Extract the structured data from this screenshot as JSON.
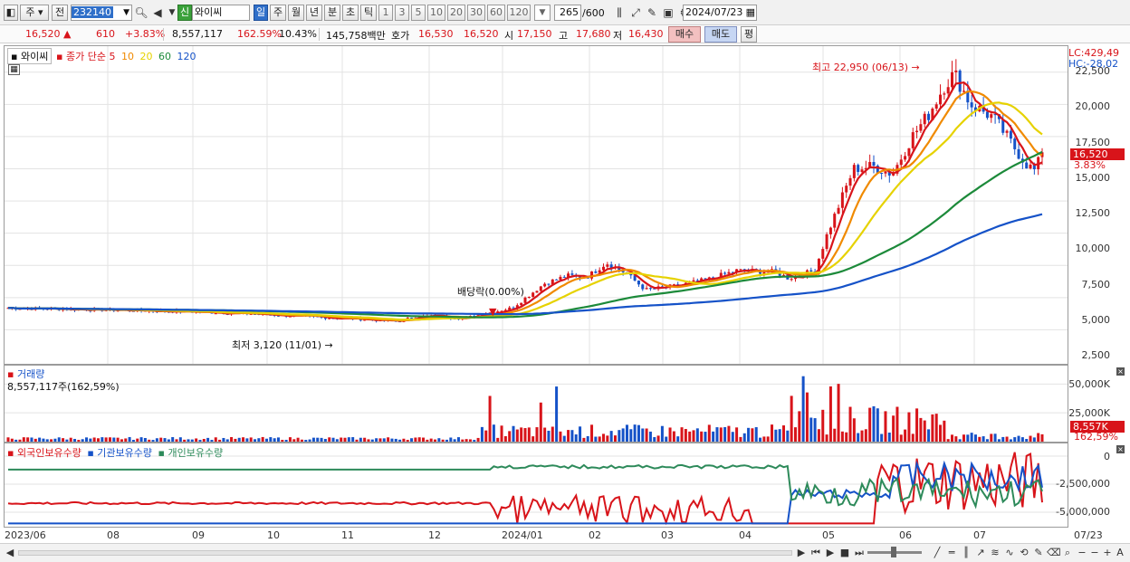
{
  "toolbar": {
    "period": "주",
    "compare": "전",
    "code": "232140",
    "credit": "신",
    "name": "와이씨",
    "tf": [
      "일",
      "주",
      "월",
      "년",
      "분",
      "초",
      "틱"
    ],
    "tf_active": "일",
    "ticks": [
      "1",
      "3",
      "5",
      "10",
      "20",
      "30",
      "60",
      "120"
    ],
    "count": "265",
    "count_total": "/600",
    "date": "2024/07/23"
  },
  "quote": {
    "price": "16,520",
    "change": "610",
    "rate": "+3.83%",
    "volume": "8,557,117",
    "vol_ratio": "162.59%",
    "turnover": "10.43%",
    "amount": "145,758백만",
    "ask_label": "호가",
    "ask": "16,530",
    "bid": "16,520",
    "open_label": "시",
    "open": "17,150",
    "high_label": "고",
    "high": "17,680",
    "low_label": "저",
    "low": "16,430",
    "buy": "매수",
    "sell": "매도",
    "eval": "평"
  },
  "price_legend": {
    "name": "와이씨",
    "ma": "종가 단순",
    "ma_periods": [
      {
        "p": "5",
        "color": "#d8141a"
      },
      {
        "p": "10",
        "color": "#f08a00"
      },
      {
        "p": "20",
        "color": "#e6d200"
      },
      {
        "p": "60",
        "color": "#1c8a3a"
      },
      {
        "p": "120",
        "color": "#1552c8"
      }
    ]
  },
  "annotations": {
    "high": "최고 22,950 (06/13)",
    "low": "최저 3,120 (11/01)",
    "dividend": "배당락(0.00%)"
  },
  "price_axis": [
    "22,500",
    "20,000",
    "17,500",
    "15,000",
    "12,500",
    "10,000",
    "7,500",
    "5,000",
    "2,500"
  ],
  "lc": "LC:429,49",
  "hc": "HC:-28,02",
  "last_tag": "16,520",
  "rate_tag": "3.83%",
  "volume_panel": {
    "title": "거래량",
    "value": "8,557,117주(162,59%)",
    "axis": [
      "50,000K",
      "25,000K"
    ],
    "tag1": "8,557K",
    "tag2": "162,59%"
  },
  "holdings_panel": {
    "series": [
      {
        "name": "외국인보유수량",
        "color": "#d8141a"
      },
      {
        "name": "기관보유수량",
        "color": "#1552c8"
      },
      {
        "name": "개인보유수량",
        "color": "#2d8a5a"
      }
    ],
    "axis": [
      "0",
      "-2,500,000",
      "-5,000,000"
    ]
  },
  "x_axis": [
    "2023/06",
    "08",
    "09",
    "10",
    "11",
    "12",
    "2024/01",
    "02",
    "03",
    "04",
    "05",
    "06",
    "07",
    "07/23"
  ],
  "colors": {
    "up": "#d8141a",
    "down": "#1552c8"
  }
}
